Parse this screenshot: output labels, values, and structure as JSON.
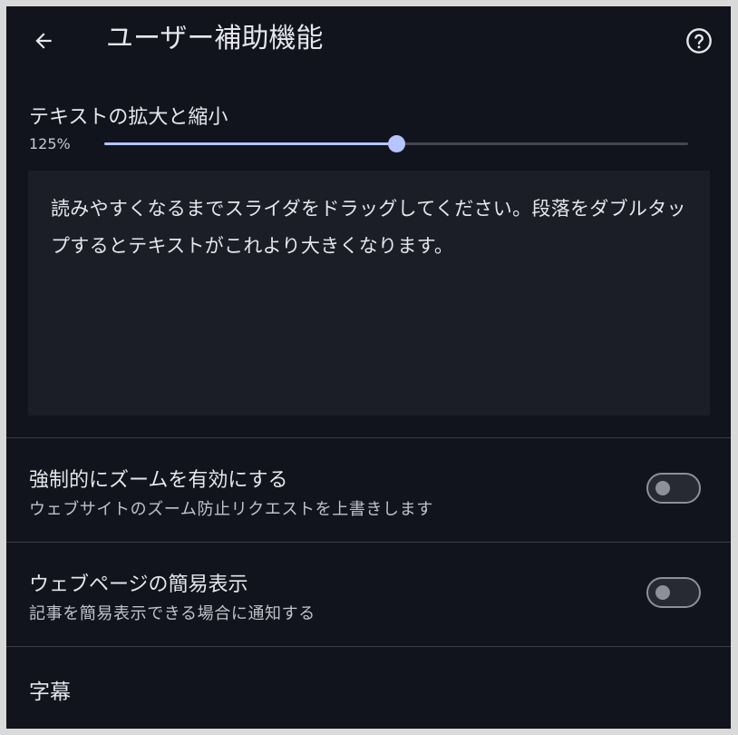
{
  "appbar": {
    "title": "ユーザー補助機能",
    "back_icon": "arrow-back-icon",
    "help_icon": "help-circle-icon"
  },
  "text_zoom": {
    "label": "テキストの拡大と縮小",
    "value_label": "125%",
    "slider_fraction": 0.5,
    "preview_text": "読みやすくなるまでスライダをドラッグしてください。段落をダブルタップするとテキストがこれより大きくなります。"
  },
  "settings": [
    {
      "title": "強制的にズームを有効にする",
      "subtitle": "ウェブサイトのズーム防止リクエストを上書きします",
      "enabled": false
    },
    {
      "title": "ウェブページの簡易表示",
      "subtitle": "記事を簡易表示できる場合に通知する",
      "enabled": false
    }
  ],
  "captions": {
    "label": "字幕"
  },
  "colors": {
    "background": "#11141d",
    "accent": "#b6c4ff",
    "preview_background": "#1b1d27"
  }
}
